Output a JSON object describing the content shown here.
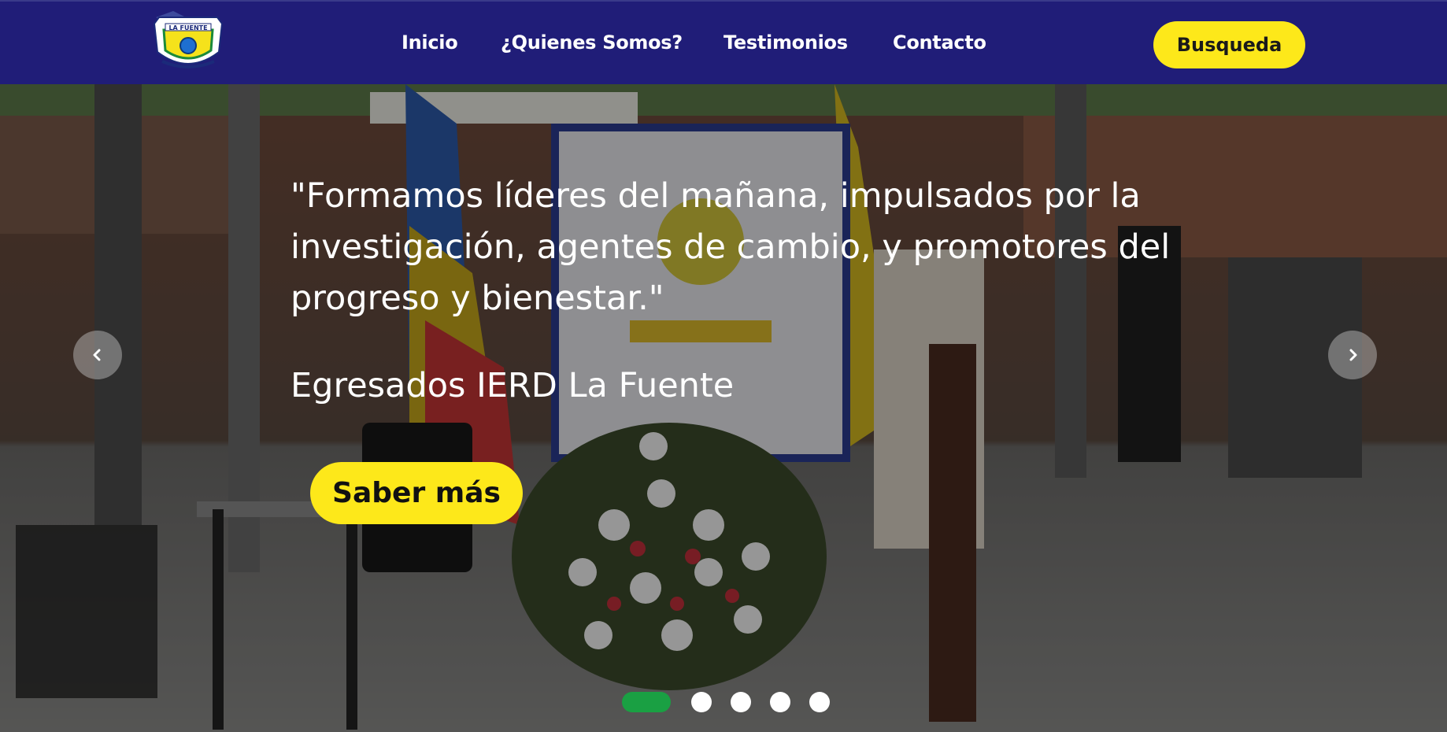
{
  "brand": {
    "logo_text": "LA FUENTE",
    "logo_icon": "school-crest-logo"
  },
  "nav": {
    "items": [
      {
        "label": "Inicio"
      },
      {
        "label": "¿Quienes Somos?"
      },
      {
        "label": "Testimonios"
      },
      {
        "label": "Contacto"
      }
    ],
    "search_label": "Busqueda"
  },
  "hero": {
    "quote": "\"Formamos líderes del mañana, impulsados por la investigación, agentes de cambio, y promotores del progreso y bienestar.\"",
    "author": "Egresados IERD La Fuente",
    "cta_label": "Saber más",
    "prev_icon": "chevron-left-icon",
    "next_icon": "chevron-right-icon",
    "slide_count": 5,
    "active_slide": 1
  },
  "colors": {
    "nav_bg": "#201d78",
    "accent_yellow": "#fde81a",
    "active_dot": "#1aa043"
  }
}
